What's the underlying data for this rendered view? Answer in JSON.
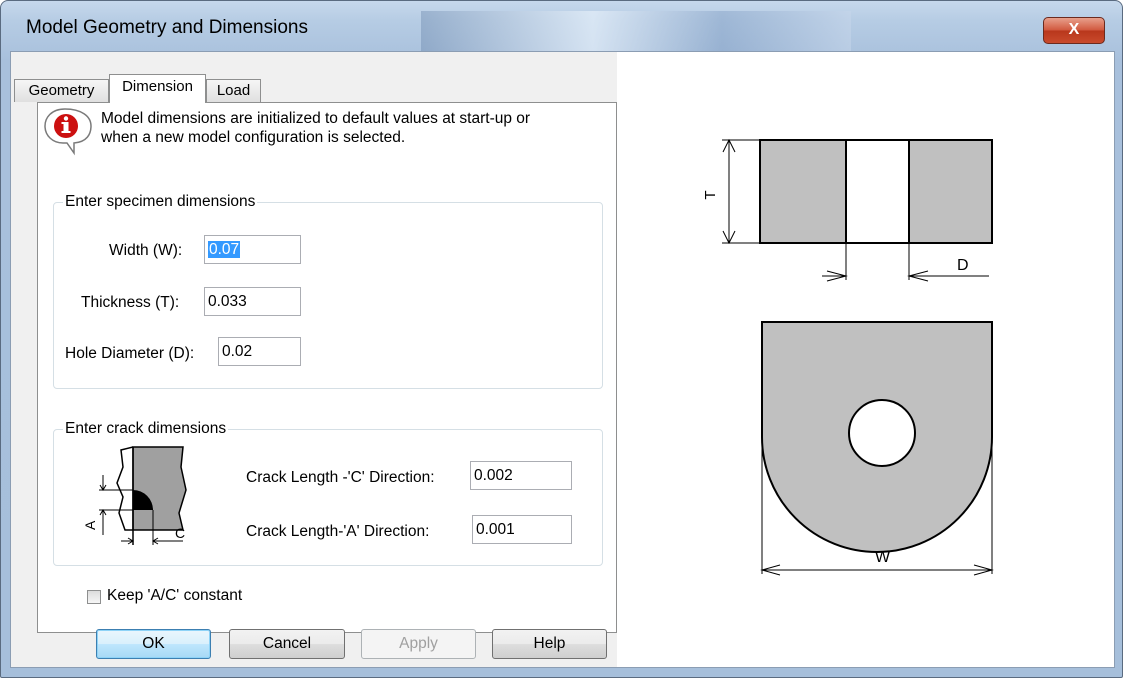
{
  "window": {
    "title": "Model Geometry and Dimensions",
    "close_glyph": "X"
  },
  "tabs": [
    {
      "label": "Geometry",
      "active": false
    },
    {
      "label": "Dimension",
      "active": true
    },
    {
      "label": "Load",
      "active": false
    }
  ],
  "info": {
    "line1": "Model dimensions are initialized to default values at start-up or",
    "line2": "when a new model  configuration  is  selected."
  },
  "specimen": {
    "group_label": "Enter  specimen dimensions",
    "width_label": "Width (W):",
    "width_value": "0.07",
    "thickness_label": "Thickness (T):",
    "thickness_value": "0.033",
    "hole_label": "Hole Diameter (D):",
    "hole_value": "0.02"
  },
  "crack": {
    "group_label": "Enter crack dimensions",
    "c_label": "Crack Length -'C' Direction:",
    "c_value": "0.002",
    "a_label": "Crack Length-'A'  Direction:",
    "a_value": "0.001",
    "diagram_a": "A",
    "diagram_c": "C"
  },
  "keep_constant": {
    "label": "Keep 'A/C' constant",
    "checked": false
  },
  "buttons": {
    "ok": "OK",
    "cancel": "Cancel",
    "apply": "Apply",
    "help": "Help"
  },
  "diagram": {
    "t_label": "T",
    "d_label": "D",
    "w_label": "W"
  },
  "colors": {
    "fill_gray": "#c0c0c0",
    "selection": "#3399ff",
    "info_red": "#cc1010"
  }
}
